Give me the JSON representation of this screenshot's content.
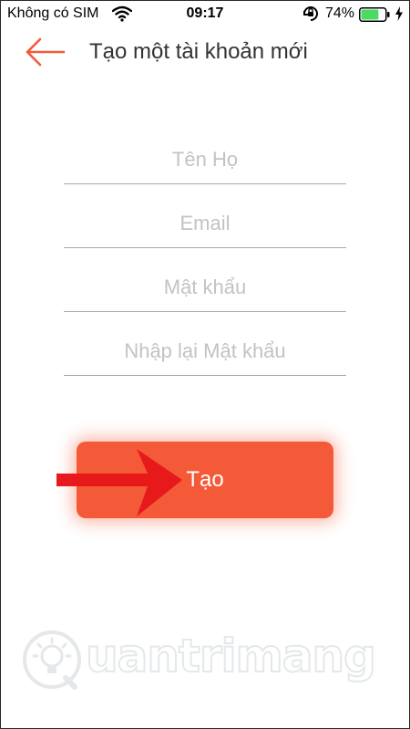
{
  "status_bar": {
    "carrier": "Không có SIM",
    "time": "09:17",
    "battery_percent": "74%",
    "battery_level": 0.74,
    "icons": [
      "wifi-icon",
      "orientation-lock-icon",
      "battery-icon",
      "charging-icon"
    ]
  },
  "header": {
    "back_icon": "arrow-left-icon",
    "title": "Tạo một tài khoản mới"
  },
  "form": {
    "name_placeholder": "Tên Họ",
    "email_placeholder": "Email",
    "password_placeholder": "Mật khẩu",
    "confirm_password_placeholder": "Nhập lại Mật khẩu",
    "name_value": "",
    "email_value": "",
    "password_value": "",
    "confirm_password_value": ""
  },
  "create_button": {
    "label": "Tạo"
  },
  "watermark": {
    "text": "uantrimang"
  },
  "colors": {
    "accent": "#f45a38",
    "arrow_annotation": "#e8191b",
    "placeholder": "#c2c2c8",
    "underline": "#a9a9a9",
    "title_text": "#333333"
  }
}
